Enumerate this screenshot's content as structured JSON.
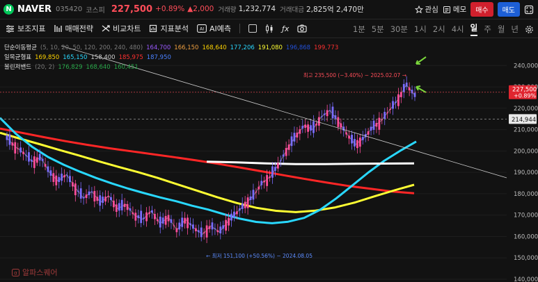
{
  "header": {
    "logo_letter": "N",
    "stock_name": "NAVER",
    "stock_code": "035420",
    "market": "코스피",
    "price": "227,500",
    "change_pct": "+0.89%",
    "change_amt": "▲2,000",
    "volume_label": "거래량",
    "volume": "1,232,774",
    "amount_label": "거래대금",
    "amount": "2,825억 2,470만",
    "favorite_label": "관심",
    "memo_label": "메모",
    "buy_label": "매수",
    "sell_label": "매도"
  },
  "toolbar": {
    "items": [
      "보조지표",
      "매매전략",
      "비교차트",
      "지표분석",
      "AI예측"
    ],
    "periods": [
      "1분",
      "5분",
      "30분",
      "1시",
      "2시",
      "4시",
      "일",
      "주",
      "월",
      "년"
    ],
    "active_period": "일"
  },
  "legend": [
    {
      "name": "단순이동평균",
      "params": "(5, 10, 20, 50, 120, 200, 240, 480)",
      "values": [
        {
          "v": "164,700",
          "color": "#9b59ff"
        },
        {
          "v": "166,150",
          "color": "#f0a040"
        },
        {
          "v": "168,640",
          "color": "#ffd400"
        },
        {
          "v": "177,206",
          "color": "#29d8ff"
        },
        {
          "v": "191,080",
          "color": "#ffff33"
        },
        {
          "v": "196,868",
          "color": "#2350d8"
        },
        {
          "v": "199,773",
          "color": "#ff3030"
        }
      ]
    },
    {
      "name": "일목균형표",
      "params": "",
      "values": [
        {
          "v": "169,850",
          "color": "#ffd400"
        },
        {
          "v": "165,150",
          "color": "#29d8ff"
        },
        {
          "v": "158,400",
          "color": "#cfcfcf"
        },
        {
          "v": "185,975",
          "color": "#ff3030"
        },
        {
          "v": "187,950",
          "color": "#4a80ff"
        }
      ]
    },
    {
      "name": "볼린저밴드",
      "params": "(20, 2)",
      "values": [
        {
          "v": "176,829",
          "color": "#29a84a"
        },
        {
          "v": "168,640",
          "color": "#29a84a"
        },
        {
          "v": "160,451",
          "color": "#29a84a"
        }
      ]
    }
  ],
  "watermark": "알파스퀘어",
  "chart_data": {
    "type": "candlestick",
    "y_axis": {
      "ticks": [
        "240,000",
        "230,000",
        "220,000",
        "210,000",
        "200,000",
        "190,000",
        "180,000",
        "170,000",
        "160,000",
        "150,000",
        "140,000"
      ]
    },
    "ylim": [
      140000,
      244000
    ],
    "current_price": {
      "label": "227,500",
      "change": "+0.89%",
      "value": 227500
    },
    "reference_price": {
      "label": "214,944",
      "value": 214944
    },
    "annotations": {
      "high": {
        "text": "최고 235,500 (−3.40%) − 2025.02.07",
        "value": 235500
      },
      "low": {
        "text": "최저 151,100 (+50.56%) − 2024.08.05",
        "value": 151100
      }
    },
    "series": [
      {
        "name": "SMA 480",
        "color": "#ff2626",
        "values": [
          210500,
          208500,
          206500,
          204600,
          202900,
          201300,
          199900,
          198500,
          197100,
          195600,
          194000,
          192300,
          190500,
          188700,
          186900,
          185200,
          183600,
          182300,
          181000,
          180200
        ]
      },
      {
        "name": "SMA 240",
        "color": "#ffff33",
        "values": [
          208500,
          205800,
          203200,
          200500,
          197900,
          195200,
          192600,
          190100,
          187400,
          184400,
          181400,
          178400,
          175700,
          173400,
          172000,
          171400,
          172100,
          173600,
          175900,
          178800,
          181600,
          184200
        ]
      },
      {
        "name": "SMA 120",
        "color": "#29d8ff",
        "values": [
          215500,
          208000,
          202000,
          197200,
          193500,
          190300,
          187400,
          184800,
          182400,
          180300,
          178300,
          176500,
          174400,
          172600,
          170400,
          168300,
          166800,
          166200,
          166900,
          168700,
          172500,
          177800,
          183800,
          189900,
          195400,
          200100,
          204400
        ]
      },
      {
        "name": "SMA 200",
        "color": "#ffffff",
        "values": [
          195000,
          194700,
          194200,
          193900,
          193900,
          194000,
          194100,
          194200
        ]
      },
      {
        "name": "Close",
        "color": "#cfcfcf",
        "values": [
          206000,
          202000,
          199000,
          195000,
          197000,
          190000,
          186000,
          189000,
          183000,
          178000,
          181000,
          176000,
          179000,
          173000,
          175000,
          170000,
          168000,
          172000,
          166000,
          169000,
          163000,
          168000,
          164000,
          161000,
          165000,
          162000,
          167000,
          171000,
          175000,
          179000,
          185000,
          188000,
          194000,
          201000,
          207000,
          212000,
          210000,
          216000,
          219000,
          214000,
          208000,
          203000,
          206000,
          211000,
          214000,
          219000,
          224000,
          231000,
          226000
        ]
      }
    ]
  }
}
